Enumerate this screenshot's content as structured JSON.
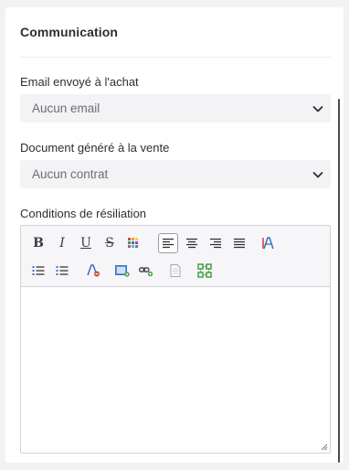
{
  "section": {
    "title": "Communication"
  },
  "email_field": {
    "label": "Email envoyé à l'achat",
    "value": "Aucun email"
  },
  "document_field": {
    "label": "Document généré à la vente",
    "value": "Aucun contrat"
  },
  "terms_field": {
    "label": "Conditions de résiliation",
    "content": ""
  },
  "toolbar": {
    "row1": [
      "bold-icon",
      "italic-icon",
      "underline-icon",
      "strikethrough-icon",
      "text-color-icon",
      "align-left-icon",
      "align-center-icon",
      "align-right-icon",
      "align-justify-icon",
      "clear-format-icon"
    ],
    "row2": [
      "bulleted-list-icon",
      "numbered-list-icon",
      "remove-format-icon",
      "insert-image-icon",
      "insert-link-icon",
      "paste-document-icon",
      "show-blocks-icon"
    ],
    "glyphs": {
      "bold": "B",
      "italic": "I",
      "underline": "U",
      "strike": "S"
    },
    "active": "align-left-icon"
  },
  "colors": {
    "accent_red": "#d9453a",
    "accent_green": "#3a9a3a",
    "accent_blue": "#3a6fc4"
  }
}
